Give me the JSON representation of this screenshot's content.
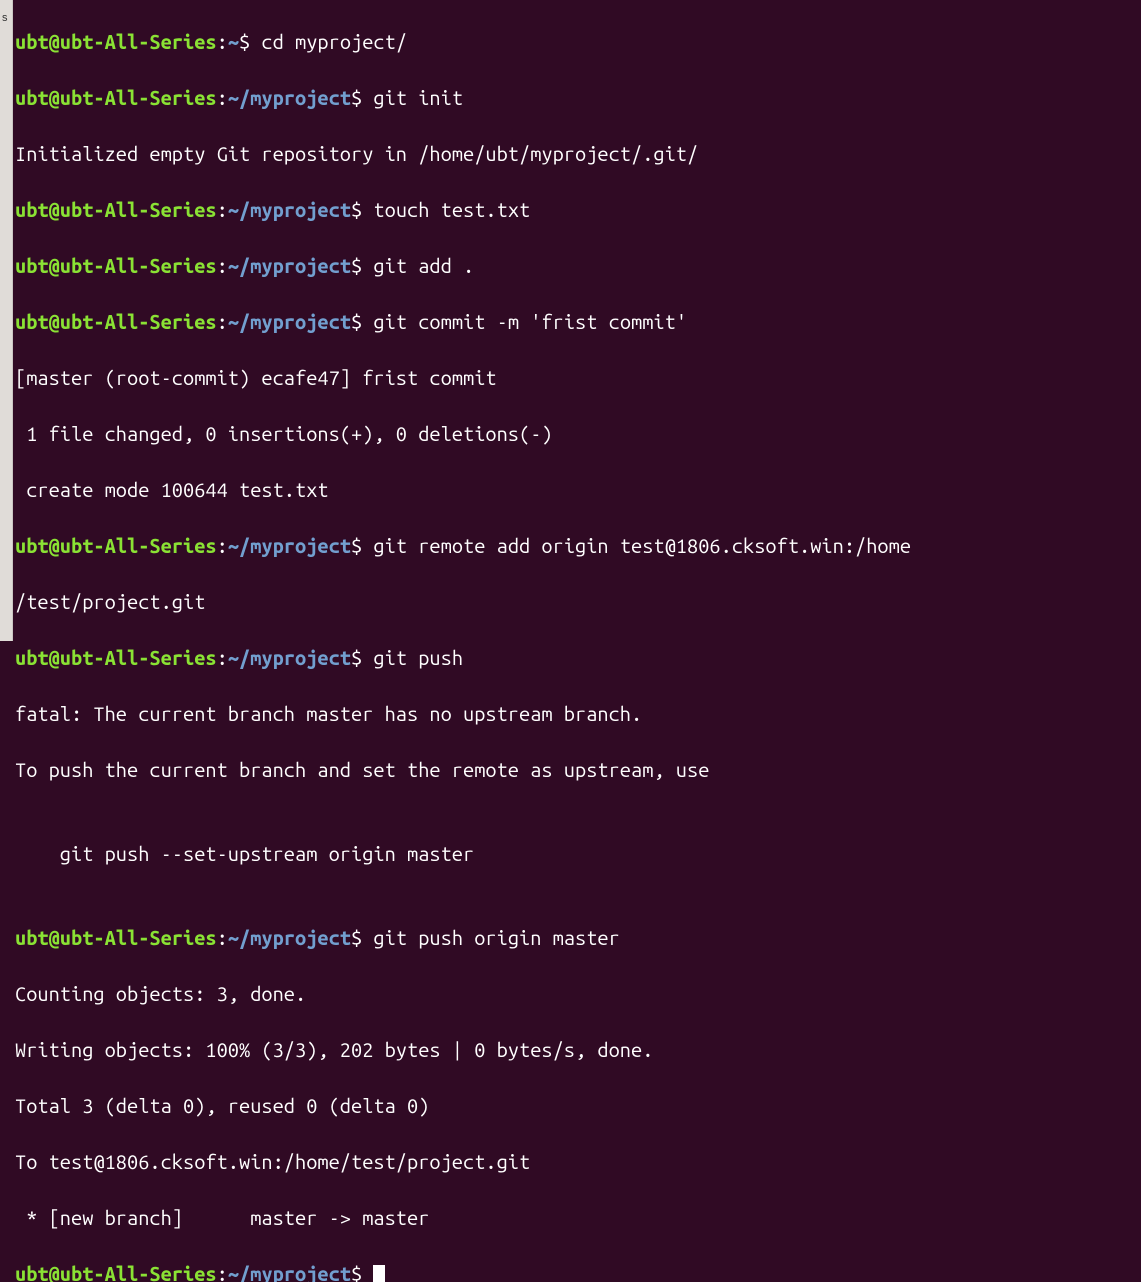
{
  "leftbar": {
    "s": "s"
  },
  "prompt": {
    "user": "ubt@ubt-All-Series",
    "home": "~",
    "project": "~/myproject",
    "sep": ":",
    "dollar": "$"
  },
  "lines": {
    "cmd_cd": " cd myproject/",
    "cmd_init": " git init",
    "out_init": "Initialized empty Git repository in /home/ubt/myproject/.git/",
    "cmd_touch": " touch test.txt",
    "cmd_add": " git add .",
    "cmd_commit": " git commit -m 'frist commit'",
    "out_commit1": "[master (root-commit) ecafe47] frist commit",
    "out_commit2": " 1 file changed, 0 insertions(+), 0 deletions(-)",
    "out_commit3": " create mode 100644 test.txt",
    "cmd_remote": " git remote add origin test@1806.cksoft.win:/home",
    "out_remote2": "/test/project.git",
    "cmd_push1": " git push",
    "out_push1a": "fatal: The current branch master has no upstream branch.",
    "out_push1b": "To push the current branch and set the remote as upstream, use",
    "out_push1c": "",
    "out_push1d": "    git push --set-upstream origin master",
    "out_push1e": "",
    "cmd_push2": " git push origin master",
    "out_push2a": "Counting objects: 3, done.",
    "out_push2b": "Writing objects: 100% (3/3), 202 bytes | 0 bytes/s, done.",
    "out_push2c": "Total 3 (delta 0), reused 0 (delta 0)",
    "out_push2d": "To test@1806.cksoft.win:/home/test/project.git",
    "out_push2e": " * [new branch]      master -> master"
  }
}
